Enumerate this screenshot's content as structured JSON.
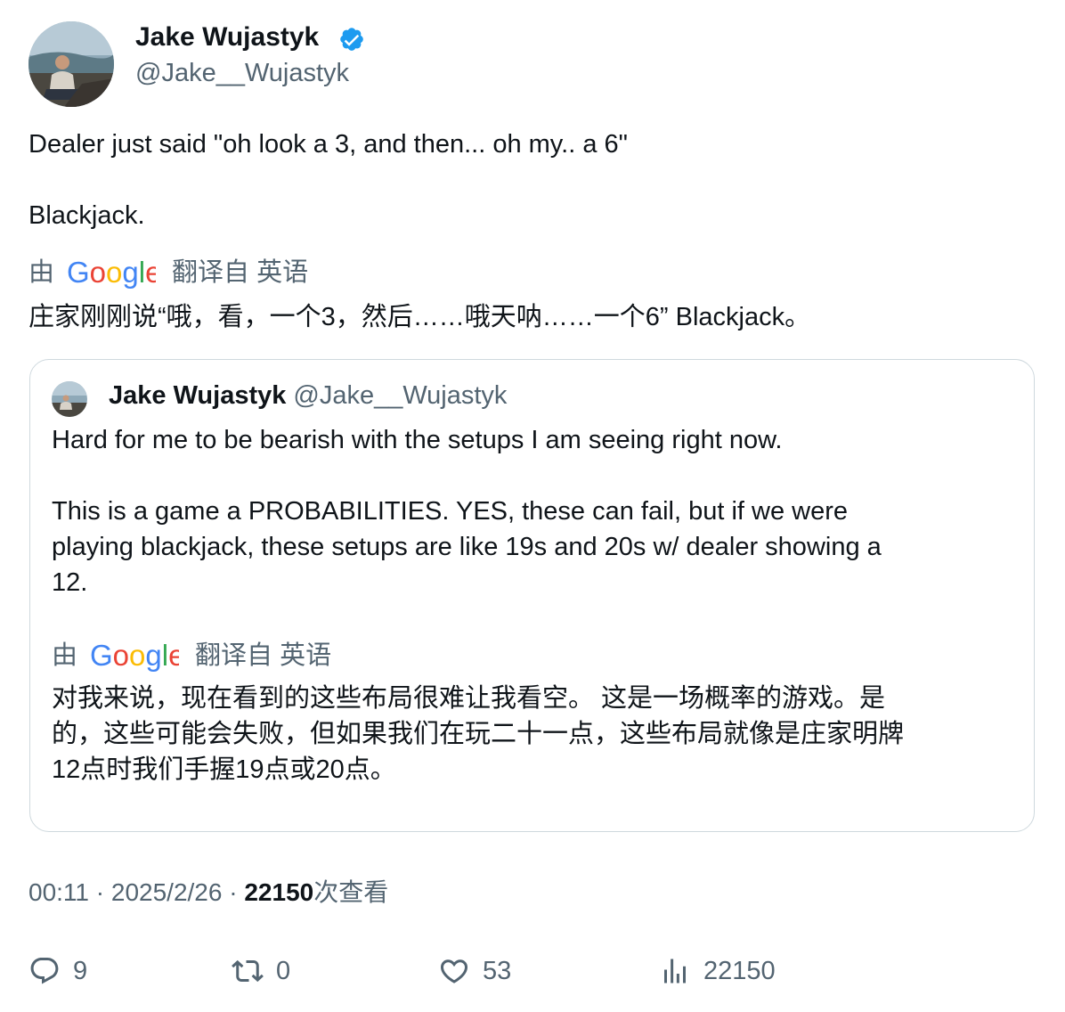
{
  "author": {
    "name": "Jake Wujastyk",
    "handle": "@Jake__Wujastyk",
    "verified": true
  },
  "tweet": {
    "lines": [
      "Dealer just said \"oh look a 3, and then... oh my.. a 6\"",
      "Blackjack."
    ],
    "translation": {
      "prefix": "由",
      "provider_logo": "Google",
      "suffix": "翻译自 英语",
      "text": "庄家刚刚说“哦，看，一个3，然后……哦天呐……一个6” Blackjack。"
    }
  },
  "quoted_tweet": {
    "name": "Jake Wujastyk",
    "handle": "@Jake__Wujastyk",
    "lines": [
      "Hard for me to be bearish with the setups I am seeing right now.",
      "This is a game a PROBABILITIES. YES, these can fail, but if we were",
      "playing blackjack, these setups are like 19s and 20s w/ dealer showing a",
      "12."
    ],
    "translation": {
      "prefix": "由",
      "provider_logo": "Google",
      "suffix": "翻译自 英语",
      "lines": [
        "对我来说，现在看到的这些布局很难让我看空。 这是一场概率的游戏。是",
        "的，这些可能会失败，但如果我们在玩二十一点，这些布局就像是庄家明牌",
        "12点时我们手握19点或20点。"
      ]
    }
  },
  "meta": {
    "time": "00:11",
    "separator": "·",
    "date": "2025/2/26",
    "views_count": "22150",
    "views_label": "次查看"
  },
  "actions": {
    "replies": "9",
    "retweets": "0",
    "likes": "53",
    "views": "22150"
  },
  "colors": {
    "text": "#0f1419",
    "secondary": "#536471",
    "verified": "#1d9bf0",
    "border": "#cfd9de"
  }
}
